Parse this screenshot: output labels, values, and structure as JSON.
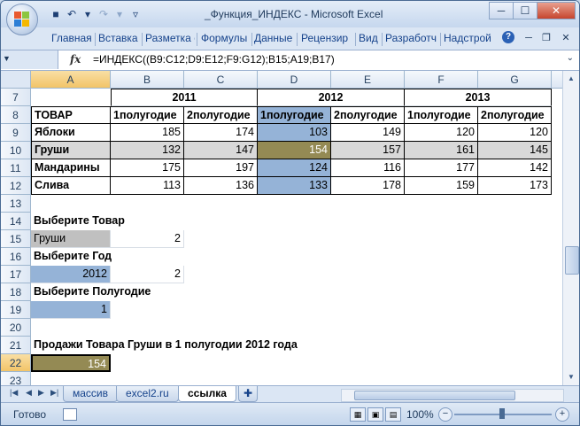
{
  "window": {
    "title": "_Функция_ИНДЕКС - Microsoft Excel",
    "controls": {
      "minimize": "─",
      "maximize": "☐",
      "close": "✕"
    }
  },
  "ribbon": {
    "tabs": [
      "Главная",
      "Вставка",
      "Разметка с",
      "Формулы",
      "Данные",
      "Рецензир",
      "Вид",
      "Разработч",
      "Надстрой"
    ]
  },
  "formula_bar": {
    "fx_label": "fx",
    "formula": "=ИНДЕКС((B9:C12;D9:E12;F9:G12);B15;A19;B17)"
  },
  "grid": {
    "columns": [
      "A",
      "B",
      "C",
      "D",
      "E",
      "F",
      "G"
    ],
    "active_column": "A",
    "active_row": "22",
    "rows": [
      "7",
      "8",
      "9",
      "10",
      "11",
      "12",
      "13",
      "14",
      "15",
      "16",
      "17",
      "18",
      "19",
      "20",
      "21",
      "22",
      "23"
    ]
  },
  "table": {
    "years": [
      "2011",
      "2012",
      "2013"
    ],
    "header_label": "ТОВАР",
    "half_headers": [
      "1полугодие",
      "2полугодие",
      "1полугодие",
      "2полугодие",
      "1полугодие",
      "2полугодие"
    ],
    "products": [
      {
        "name": "Яблоки",
        "values": [
          "185",
          "174",
          "103",
          "149",
          "120",
          "120"
        ]
      },
      {
        "name": "Груши",
        "values": [
          "132",
          "147",
          "154",
          "157",
          "161",
          "145"
        ]
      },
      {
        "name": "Мандарины",
        "values": [
          "175",
          "197",
          "124",
          "116",
          "177",
          "142"
        ]
      },
      {
        "name": "Слива",
        "values": [
          "113",
          "136",
          "133",
          "178",
          "159",
          "173"
        ]
      }
    ]
  },
  "inputs": {
    "product_label": "Выберите Товар",
    "product_value": "Груши",
    "product_index": "2",
    "year_label": "Выберите Год",
    "year_value": "2012",
    "year_index": "2",
    "half_label": "Выберите Полугодие",
    "half_value": "1",
    "result_label": "Продажи Товара Груши в 1 полугодии 2012 года",
    "result_value": "154"
  },
  "sheets": {
    "tabs": [
      "массив",
      "excel2.ru",
      "ссылка"
    ],
    "active": "ссылка"
  },
  "status": {
    "text": "Готово",
    "zoom": "100%"
  },
  "colors": {
    "blue_fill": "#95b3d7",
    "gray_fill": "#c0c0c0",
    "olive_fill": "#948a54",
    "light_gray_row": "#d9d9d9"
  }
}
